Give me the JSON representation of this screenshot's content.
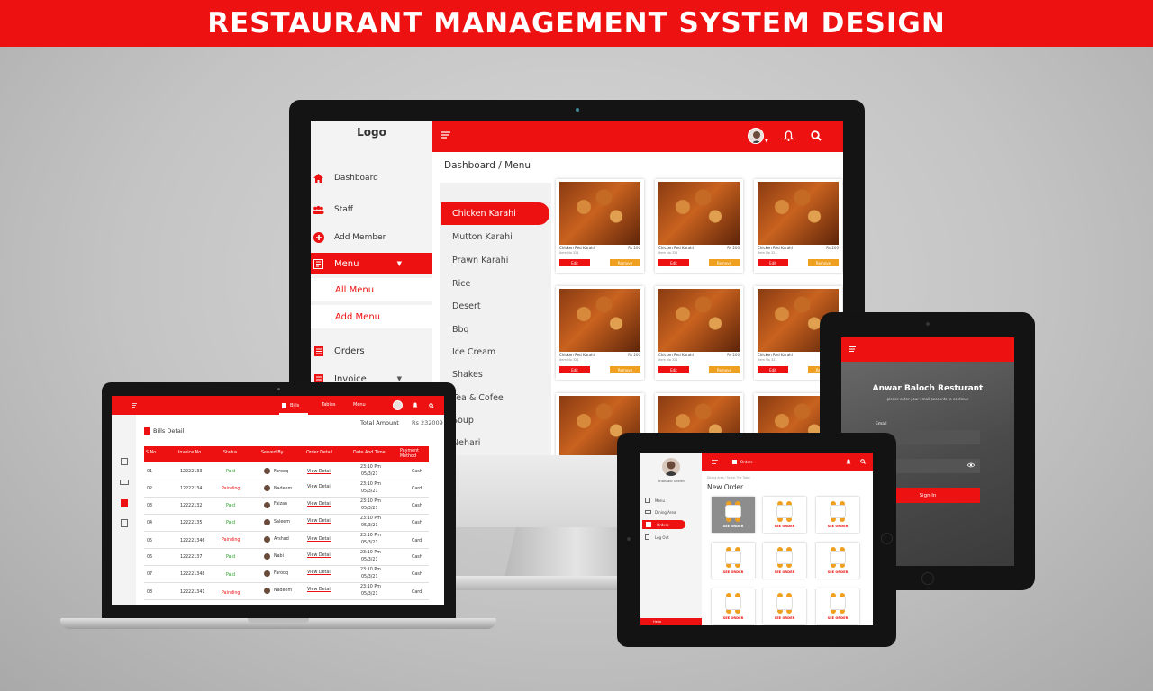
{
  "banner": {
    "title": "RESTAURANT MANAGEMENT SYSTEM DESIGN"
  },
  "colors": {
    "accent": "#ee1111",
    "secondary": "#f0a020",
    "paid": "#2a9d2a"
  },
  "desktop": {
    "logo": "Logo",
    "nav": [
      {
        "label": "Dashboard",
        "icon": "home-icon"
      },
      {
        "label": "Staff",
        "icon": "staff-icon"
      },
      {
        "label": "Add Member",
        "icon": "plus-circle-icon"
      },
      {
        "label": "Menu",
        "icon": "menu-book-icon"
      }
    ],
    "submenu": [
      "All Menu",
      "Add Menu"
    ],
    "nav_more": [
      {
        "label": "Orders",
        "icon": "orders-icon"
      },
      {
        "label": "Invoice",
        "icon": "invoice-icon"
      }
    ],
    "breadcrumb": "Dashboard / Menu",
    "categories": [
      "Chicken Karahi",
      "Mutton Karahi",
      "Prawn Karahi",
      "Rice",
      "Desert",
      "Bbq",
      "Ice Cream",
      "Shakes",
      "Tea & Cofee",
      "Soup",
      "Nehari"
    ],
    "card": {
      "name": "Chicken Red Karahi",
      "price": "Rs 200",
      "item_no": "Item No 321",
      "edit": "Edit",
      "remove": "Remove"
    }
  },
  "laptop": {
    "tabs": [
      "Bills",
      "Tables",
      "Menu"
    ],
    "title": "Bills Detail",
    "total_label": "Total Amount",
    "total_value": "Rs 232009",
    "headers": [
      "S.No",
      "Invoice No",
      "Status",
      "Served By",
      "Order Detail",
      "Date And Time",
      "Payment Method"
    ],
    "view_label": "View Detail",
    "rows": [
      {
        "sno": "01",
        "invoice": "12222133",
        "status": "Paid",
        "server": "Farooq",
        "time": "23:10 Pm",
        "date": "05/3/21",
        "method": "Cash"
      },
      {
        "sno": "02",
        "invoice": "12222134",
        "status": "Painding",
        "server": "Nadeem",
        "time": "23:10 Pm",
        "date": "05/3/21",
        "method": "Card"
      },
      {
        "sno": "03",
        "invoice": "12222132",
        "status": "Paid",
        "server": "Faizan",
        "time": "23:10 Pm",
        "date": "05/3/21",
        "method": "Cash"
      },
      {
        "sno": "04",
        "invoice": "12222135",
        "status": "Paid",
        "server": "Saleem",
        "time": "23:10 Pm",
        "date": "05/3/21",
        "method": "Cash"
      },
      {
        "sno": "05",
        "invoice": "122221346",
        "status": "Painding",
        "server": "Arshad",
        "time": "23:10 Pm",
        "date": "05/3/21",
        "method": "Card"
      },
      {
        "sno": "06",
        "invoice": "12222137",
        "status": "Paid",
        "server": "Nabi",
        "time": "23:10 Pm",
        "date": "05/3/21",
        "method": "Cash"
      },
      {
        "sno": "07",
        "invoice": "122221348",
        "status": "Paid",
        "server": "Farooq",
        "time": "23:10 Pm",
        "date": "05/3/21",
        "method": "Cash"
      },
      {
        "sno": "08",
        "invoice": "122221341",
        "status": "Painding",
        "server": "Nadeem",
        "time": "23:10 Pm",
        "date": "05/3/21",
        "method": "Card"
      }
    ]
  },
  "tablet_login": {
    "title": "Anwar Baloch Resturant",
    "subtitle": "please enter your email accounts to continue",
    "email_label": "Email",
    "password_value": "•••",
    "signin": "Sign In"
  },
  "tablet_orders": {
    "top_label": "Orders",
    "user_name": "Shahzaib Sheikh",
    "nav": [
      "Menu",
      "Dining Area",
      "Orders",
      "Log Out"
    ],
    "breadcrumb": "Dining Area / Select The Table",
    "title": "New Order",
    "tile_label": "SEE ORDER",
    "footer": "Hello"
  }
}
